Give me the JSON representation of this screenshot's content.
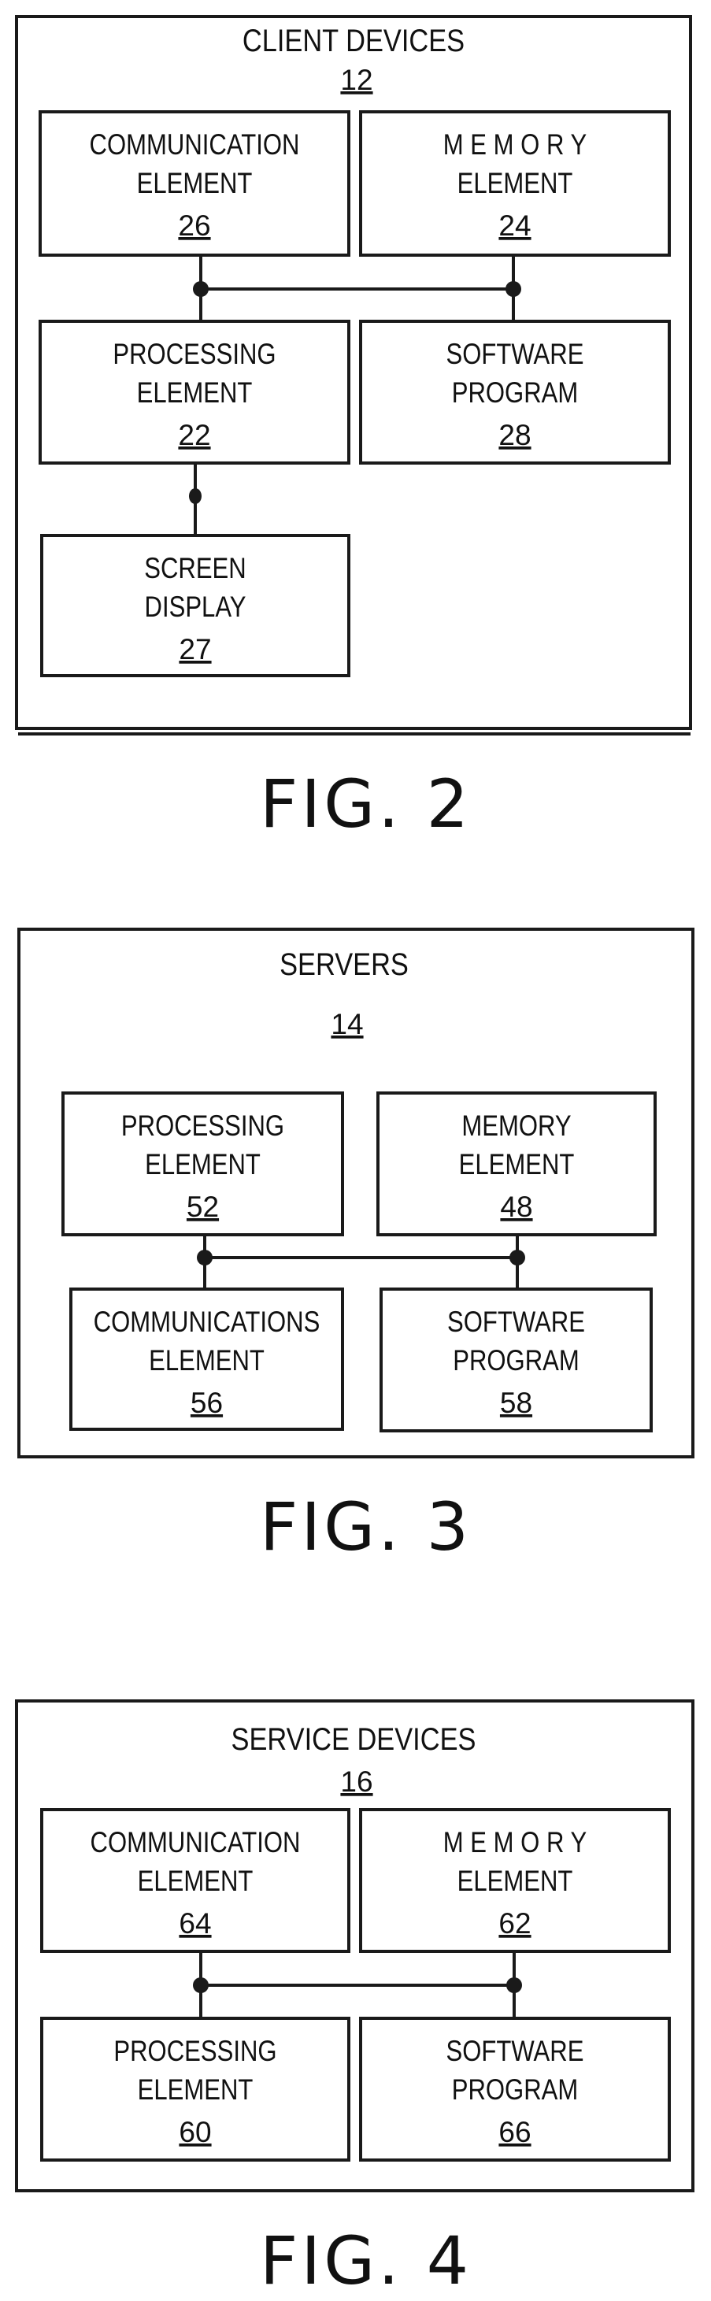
{
  "figures": [
    {
      "id": "fig2",
      "caption": "FIG. 2",
      "title": "CLIENT DEVICES",
      "ref": "12",
      "blocks": [
        {
          "key": "communication",
          "lines": [
            "COMMUNICATION",
            "ELEMENT"
          ],
          "ref": "26"
        },
        {
          "key": "memory",
          "lines": [
            "M E M O R Y",
            "ELEMENT"
          ],
          "ref": "24"
        },
        {
          "key": "processing",
          "lines": [
            "PROCESSING",
            "ELEMENT"
          ],
          "ref": "22"
        },
        {
          "key": "software",
          "lines": [
            "SOFTWARE",
            "PROGRAM"
          ],
          "ref": "28"
        },
        {
          "key": "screen",
          "lines": [
            "SCREEN",
            "DISPLAY"
          ],
          "ref": "27"
        }
      ],
      "connections": [
        [
          "communication",
          "processing"
        ],
        [
          "memory",
          "software"
        ],
        [
          "communication",
          "memory"
        ],
        [
          "processing",
          "screen"
        ]
      ]
    },
    {
      "id": "fig3",
      "caption": "FIG. 3",
      "title": "SERVERS",
      "ref": "14",
      "blocks": [
        {
          "key": "processing",
          "lines": [
            "PROCESSING",
            "ELEMENT"
          ],
          "ref": "52"
        },
        {
          "key": "memory",
          "lines": [
            "MEMORY",
            "ELEMENT"
          ],
          "ref": "48"
        },
        {
          "key": "communications",
          "lines": [
            "COMMUNICATIONS",
            "ELEMENT"
          ],
          "ref": "56"
        },
        {
          "key": "software",
          "lines": [
            "SOFTWARE",
            "PROGRAM"
          ],
          "ref": "58"
        }
      ],
      "connections": [
        [
          "processing",
          "communications"
        ],
        [
          "memory",
          "software"
        ],
        [
          "processing",
          "memory"
        ]
      ]
    },
    {
      "id": "fig4",
      "caption": "FIG. 4",
      "title": "SERVICE DEVICES",
      "ref": "16",
      "blocks": [
        {
          "key": "communication",
          "lines": [
            "COMMUNICATION",
            "ELEMENT"
          ],
          "ref": "64"
        },
        {
          "key": "memory",
          "lines": [
            "M E M O R Y",
            "ELEMENT"
          ],
          "ref": "62"
        },
        {
          "key": "processing",
          "lines": [
            "PROCESSING",
            "ELEMENT"
          ],
          "ref": "60"
        },
        {
          "key": "software",
          "lines": [
            "SOFTWARE",
            "PROGRAM"
          ],
          "ref": "66"
        }
      ],
      "connections": [
        [
          "communication",
          "processing"
        ],
        [
          "memory",
          "software"
        ],
        [
          "communication",
          "memory"
        ]
      ]
    }
  ]
}
